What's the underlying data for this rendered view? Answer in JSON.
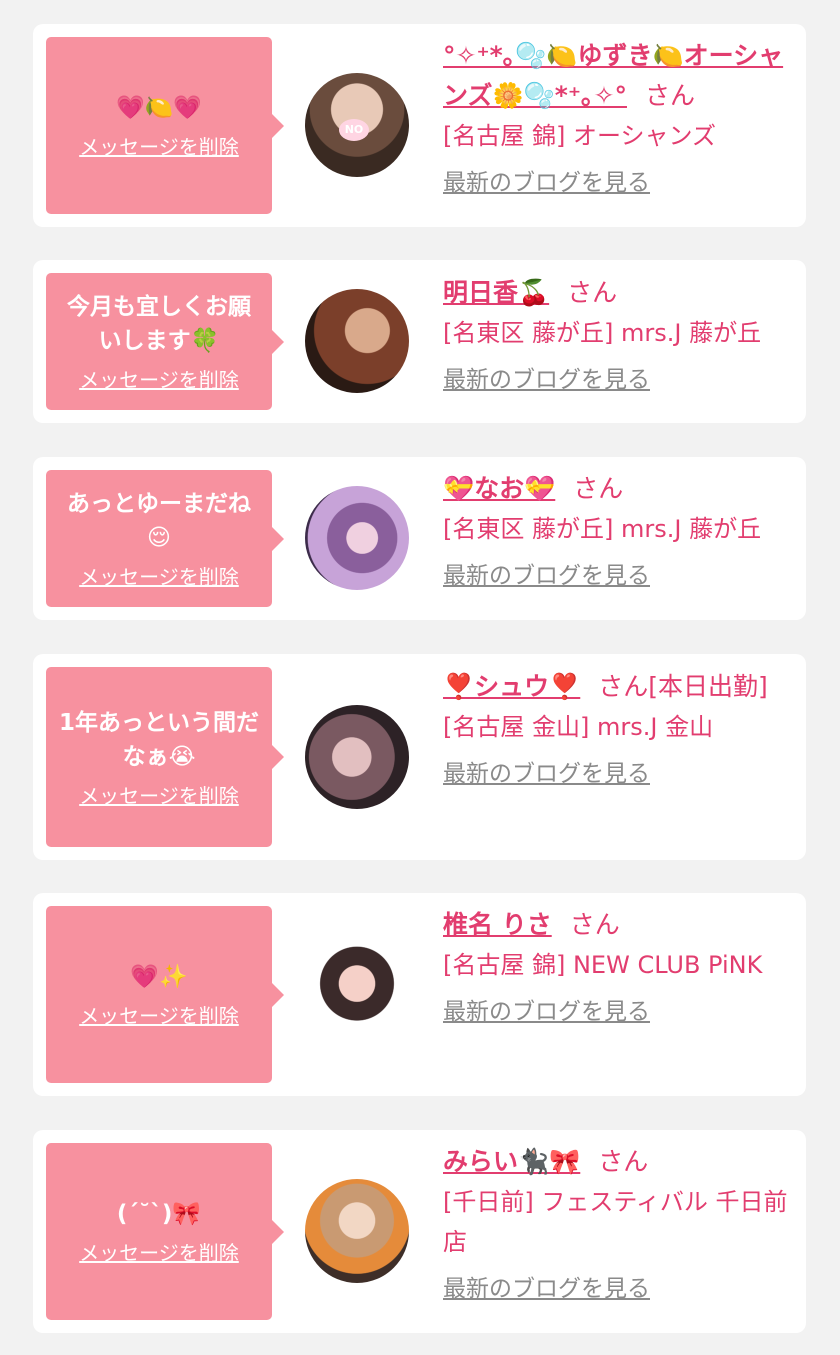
{
  "delete_label": "メッセージを削除",
  "blog_label": "最新のブログを見る",
  "san_label": "さん",
  "cards": [
    {
      "message": "💗🍋💗",
      "name": "°✧⁺*｡🫧🍋ゆずき🍋オーシャンズ🌼🫧*⁺｡✧°",
      "san": "さん",
      "status": "",
      "shop": "[名古屋 錦] オーシャンズ",
      "avatar_icon": "girl-avatar-no-logo"
    },
    {
      "message": "今月も宜しくお願いします🍀",
      "name": "明日香🍒",
      "san": "さん",
      "status": "",
      "shop": "[名東区 藤が丘] mrs.J 藤が丘",
      "avatar_icon": "girl-avatar"
    },
    {
      "message": "あっとゆーまだね😌",
      "name": "💝なお💝",
      "san": "さん",
      "status": "",
      "shop": "[名東区 藤が丘] mrs.J 藤が丘",
      "avatar_icon": "girl-avatar"
    },
    {
      "message": "1年あっという間だなぁ😭",
      "name": "❣️シュウ❣️",
      "san": "さん",
      "status": "[本日出勤]",
      "shop": "[名古屋 金山] mrs.J 金山",
      "avatar_icon": "girl-avatar"
    },
    {
      "message": "💗✨",
      "name": "椎名 りさ",
      "san": "さん",
      "status": "",
      "shop": "[名古屋 錦] NEW CLUB PiNK",
      "avatar_icon": "girl-avatar"
    },
    {
      "message": "(ˊ˘ˋ)🎀",
      "name": "みらい🐈‍⬛🎀",
      "san": "さん",
      "status": "",
      "shop": "[千日前] フェスティバル 千日前店",
      "avatar_icon": "girl-avatar"
    }
  ],
  "colors": {
    "page_bg": "#f2f2f2",
    "bubble": "#f7919f",
    "accent": "#e23d6f",
    "link_gray": "#8a8a8a"
  }
}
